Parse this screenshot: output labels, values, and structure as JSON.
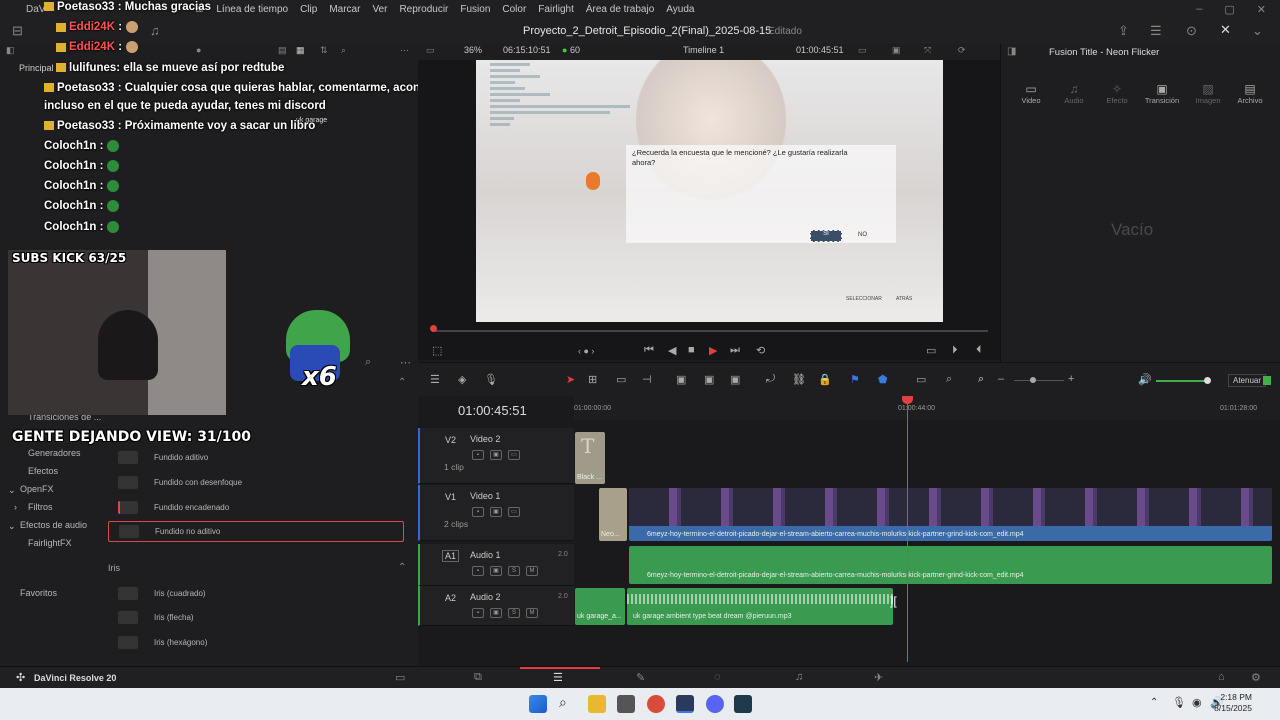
{
  "menubar": {
    "app": "DaV",
    "items": [
      "Línea de tiempo",
      "Clip",
      "Marcar",
      "Ver",
      "Reproducir",
      "Fusion",
      "Color",
      "Fairlight",
      "Área de trabajo",
      "Ayuda"
    ],
    "partial": "ar"
  },
  "titlebar": {
    "project": "Proyecto_2_Detroit_Episodio_2(Final)_2025-08-15",
    "status": "Editado"
  },
  "viewer": {
    "zoom": "36%",
    "timecode_src": "06:15:10:51",
    "fps": "60",
    "timeline_name": "Timeline 1",
    "timecode": "01:00:45:51",
    "question": "¿Recuerda la encuesta que le mencioné? ¿Le gustaría realizarla ahora?",
    "yes": "SÍ",
    "no": "NO",
    "footer_left": "SELECCIONAR",
    "footer_right": "ATRÁS"
  },
  "inspector": {
    "title": "Fusion Title - Neon Flicker",
    "tabs": [
      "Video",
      "Audio",
      "Efecto",
      "Transición",
      "Imagen",
      "Archivo"
    ],
    "empty": "Vacío"
  },
  "chat": [
    {
      "user": "Poetaso33",
      "msg": ": Muchas gracias"
    },
    {
      "user": "Eddi24K",
      "msg": ":"
    },
    {
      "user": "Eddi24K",
      "msg": ":"
    },
    {
      "user": "lulifunes",
      "msg": ": ella se mueve así por redtube"
    },
    {
      "user": "Poetaso33",
      "msg": ": Cualquier cosa que quieras hablar, comentarme, aconsejarme, o"
    },
    {
      "user": "",
      "msg": "incluso en el que te pueda ayudar, tenes mi discord"
    },
    {
      "user": "Poetaso33",
      "msg": ": Próximamente voy a sacar un libro"
    },
    {
      "user": "Coloch1n",
      "msg": ":"
    },
    {
      "user": "Coloch1n",
      "msg": ":"
    },
    {
      "user": "Coloch1n",
      "msg": ":"
    },
    {
      "user": "Coloch1n",
      "msg": ":"
    },
    {
      "user": "Coloch1n",
      "msg": ":"
    }
  ],
  "overlay": {
    "subs": "SUBS KICK 63/25",
    "view": "GENTE DEJANDO VIEW: 31/100",
    "multiplier": "x6",
    "principal": "Principal",
    "garage": "uk garage"
  },
  "sidenav": [
    "Transiciones de ...",
    "Generadores",
    "Efectos",
    "OpenFX",
    "Filtros",
    "Efectos de audio",
    "FairlightFX",
    "Favoritos"
  ],
  "effects": {
    "items": [
      "Fundido aditivo",
      "Fundido con desenfoque",
      "Fundido encadenado",
      "Fundido no aditivo"
    ],
    "iris_section": "Iris",
    "iris": [
      "Iris (cuadrado)",
      "Iris (flecha)",
      "Iris (hexágono)"
    ]
  },
  "timeline": {
    "timecode": "01:00:45:51",
    "ruler": [
      "01:00:00:00",
      "01:00:44:00",
      "01:01:28:00"
    ],
    "tracks": {
      "v2": {
        "id": "V2",
        "name": "Video 2",
        "count": "1 clip",
        "clip": "Black ..."
      },
      "v1": {
        "id": "V1",
        "name": "Video 1",
        "count": "2 clips",
        "clip_short": "Neo...",
        "clip": ""
      },
      "a1": {
        "id": "A1",
        "name": "Audio 1",
        "level": "2.0",
        "clip": "6meyz-hoy-termino-el-detroit-picado-dejar-el-stream-abierto-carrea-muchis-molurks-kick-partner-grind-kick-com_edit.mp4"
      },
      "a2": {
        "id": "A2",
        "name": "Audio 2",
        "level": "2.0",
        "clip_short": "uk garage_a...",
        "clip": "uk garage  ambient type beat dream @pieruun.mp3"
      }
    },
    "video_clip_label": "6meyz-hoy-termino-el-detroit-picado-dejar-el-stream-abierto-carrea-muchis-molurks-kick-partner-grind-kick-com_edit.mp4",
    "attenuate": "Atenuar"
  },
  "pagebar": {
    "brand": "DaVinci Resolve 20"
  },
  "taskbar": {
    "time": "2:18 PM",
    "date": "8/15/2025"
  }
}
